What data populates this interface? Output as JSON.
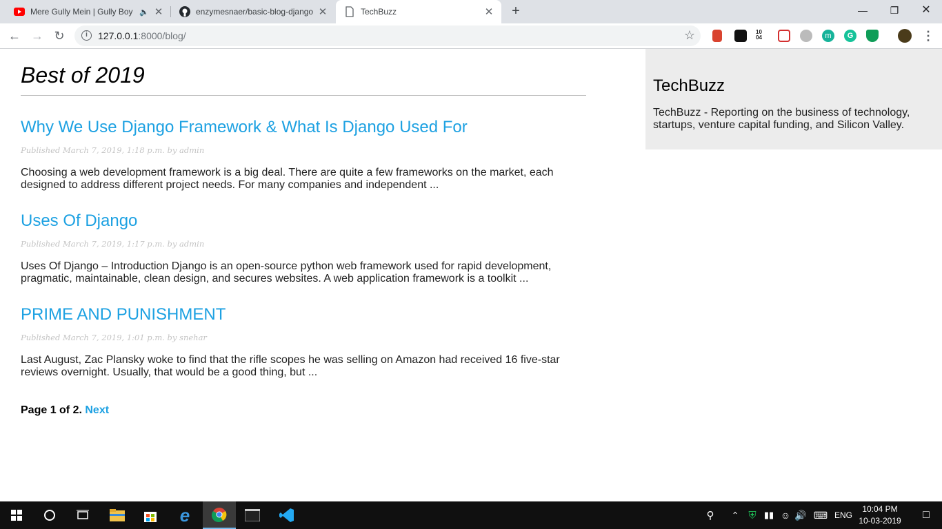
{
  "browser": {
    "tabs": [
      {
        "title": "Mere Gully Mein | Gully Boy |",
        "icon": "youtube-icon",
        "audio_icon": "speaker-icon"
      },
      {
        "title": "enzymesnaer/basic-blog-django",
        "icon": "github-icon"
      },
      {
        "title": "TechBuzz",
        "icon": "page-icon"
      }
    ],
    "url_host": "127.0.0.1",
    "url_path": ":8000/blog/",
    "ext_badge_text": "10\n04"
  },
  "blog": {
    "heading": "Best of 2019",
    "posts": [
      {
        "title": "Why We Use Django Framework & What Is Django Used For",
        "meta": "Published March 7, 2019, 1:18 p.m. by admin",
        "excerpt": "Choosing a web development framework is a big deal. There are quite a few frameworks on the market, each designed to address different project needs. For many companies and independent ..."
      },
      {
        "title": "Uses Of Django",
        "meta": "Published March 7, 2019, 1:17 p.m. by admin",
        "excerpt": "Uses Of Django – Introduction Django is an open-source python web framework used for rapid development, pragmatic, maintainable, clean design, and secures websites. A web application framework is a toolkit ..."
      },
      {
        "title": "PRIME AND PUNISHMENT",
        "meta": "Published March 7, 2019, 1:01 p.m. by snehar",
        "excerpt": "Last August, Zac Plansky woke to find that the rifle scopes he was selling on Amazon had received 16 five-star reviews overnight. Usually, that would be a good thing, but ..."
      }
    ],
    "pagination": {
      "text": "Page 1 of 2.",
      "next": "Next"
    }
  },
  "sidebar": {
    "title": "TechBuzz",
    "description": "TechBuzz - Reporting on the business of technology, startups, venture capital funding, and Silicon Valley."
  },
  "taskbar": {
    "language": "ENG",
    "time": "10:04 PM",
    "date": "10-03-2019"
  },
  "colors": {
    "link": "#1da1e2",
    "sidebar_bg": "#ececec",
    "tabstrip": "#dee1e6"
  }
}
